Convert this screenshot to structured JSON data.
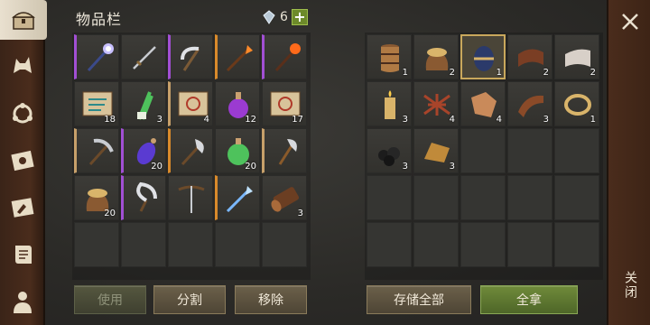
{
  "header": {
    "title": "物品栏",
    "gem_count": "6",
    "add_label": "+"
  },
  "sidebar": {
    "items": [
      {
        "name": "chest-icon",
        "active": true
      },
      {
        "name": "wolf-icon"
      },
      {
        "name": "skills-icon"
      },
      {
        "name": "map-icon"
      },
      {
        "name": "build-icon"
      },
      {
        "name": "scroll-icon"
      },
      {
        "name": "character-icon"
      }
    ]
  },
  "inventory": {
    "rows": [
      [
        {
          "icon": "magic-staff-icon",
          "q": "purple"
        },
        {
          "icon": "sword-icon"
        },
        {
          "icon": "scythe-icon",
          "q": "purple"
        },
        {
          "icon": "fire-spear-icon",
          "q": "orange"
        },
        {
          "icon": "fire-staff-icon",
          "q": "purple"
        }
      ],
      [
        {
          "icon": "map-scroll-icon",
          "count": "18"
        },
        {
          "icon": "leek-icon",
          "count": "3"
        },
        {
          "icon": "rune-scroll-icon",
          "count": "4",
          "q": "tan"
        },
        {
          "icon": "purple-potion-icon",
          "count": "12"
        },
        {
          "icon": "rune-scroll-icon",
          "count": "17"
        }
      ],
      [
        {
          "icon": "pickaxe-icon",
          "q": "tan"
        },
        {
          "icon": "mana-potion-icon",
          "count": "20",
          "q": "purple"
        },
        {
          "icon": "battle-axe-icon",
          "q": "orange"
        },
        {
          "icon": "green-potion-icon",
          "count": "20"
        },
        {
          "icon": "hand-axe-icon",
          "q": "tan"
        }
      ],
      [
        {
          "icon": "grain-sack-icon",
          "count": "20"
        },
        {
          "icon": "sickle-icon",
          "q": "purple"
        },
        {
          "icon": "crossbow-icon"
        },
        {
          "icon": "ice-spear-icon",
          "q": "orange"
        },
        {
          "icon": "wood-log-icon",
          "count": "3"
        }
      ],
      [
        {},
        {},
        {},
        {},
        {}
      ]
    ],
    "buttons": {
      "use": "使用",
      "split": "分割",
      "remove": "移除"
    }
  },
  "storage": {
    "rows": [
      [
        {
          "icon": "barrel-icon",
          "count": "1"
        },
        {
          "icon": "grain-sack-icon",
          "count": "2"
        },
        {
          "icon": "gold-egg-icon",
          "count": "1",
          "selected": true
        },
        {
          "icon": "leather-roll-icon",
          "count": "2"
        },
        {
          "icon": "cloth-roll-icon",
          "count": "2"
        }
      ],
      [
        {
          "icon": "candle-icon",
          "count": "3"
        },
        {
          "icon": "twine-icon",
          "count": "4"
        },
        {
          "icon": "leather-scrap-icon",
          "count": "4"
        },
        {
          "icon": "leather-strip-icon",
          "count": "3"
        },
        {
          "icon": "gold-ring-icon",
          "count": "1"
        }
      ],
      [
        {
          "icon": "coal-icon",
          "count": "3"
        },
        {
          "icon": "bread-loaf-icon",
          "count": "3"
        },
        {},
        {},
        {}
      ],
      [
        {},
        {},
        {},
        {},
        {}
      ],
      [
        {},
        {},
        {},
        {},
        {}
      ]
    ],
    "buttons": {
      "store_all": "存储全部",
      "take_all": "全拿"
    }
  },
  "close": {
    "label": "关闭"
  },
  "colors": {
    "purple": "#a24fd4",
    "orange": "#d98a2b",
    "tan": "#c7a06a",
    "green_btn": "#6f8a3a",
    "sidebar_brown": "#4a2c1c"
  }
}
